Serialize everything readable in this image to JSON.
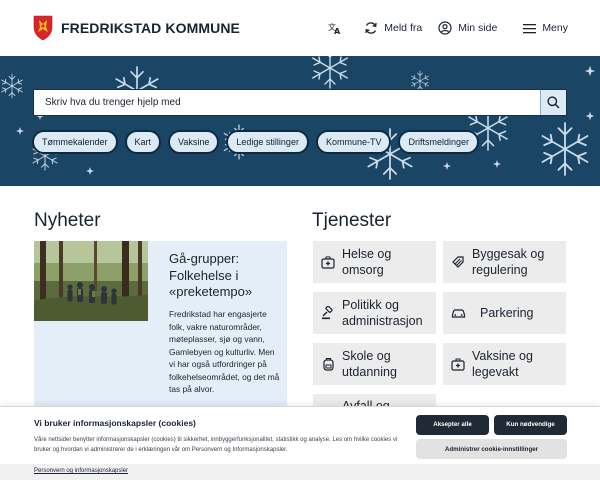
{
  "header": {
    "logo_text": "FREDRIKSTAD KOMMUNE",
    "nav": {
      "meld_fra": "Meld fra",
      "min_side": "Min side",
      "meny": "Meny"
    }
  },
  "banner": {
    "background_color": "#1b4565",
    "search_placeholder": "Skriv hva du trenger hjelp med",
    "chips": [
      "Tømmekalender",
      "Kart",
      "Vaksine",
      "Ledige stillinger",
      "Kommune-TV",
      "Driftsmeldinger"
    ]
  },
  "news": {
    "heading": "Nyheter",
    "card": {
      "title": "Gå-grupper: Folkehelse i «preketempo»",
      "body": "Fredrikstad har engasjerte folk, vakre naturområder, møteplasser, sjø og vann, Gamlebyen og kulturliv. Men vi har også utfordringer på folkehelseområdet, og det må tas på alvor."
    }
  },
  "services": {
    "heading": "Tjenester",
    "items": [
      {
        "label": "Helse og omsorg",
        "icon": "medical-kit-icon"
      },
      {
        "label": "Byggesak og regulering",
        "icon": "building-tag-icon"
      },
      {
        "label": "Politikk og administrasjon",
        "icon": "gavel-icon"
      },
      {
        "label": "Parkering",
        "icon": "car-icon"
      },
      {
        "label": "Skole og utdanning",
        "icon": "backpack-icon"
      },
      {
        "label": "Vaksine og legevakt",
        "icon": "medical-case-icon"
      },
      {
        "label": "Avfall og",
        "icon": "waste-icon"
      }
    ]
  },
  "cookie": {
    "title": "Vi bruker informasjonskapsler (cookies)",
    "text": "Våre nettsider benytter informasjonskapsler (cookies) til sikkerhet, innbyggerfunksjonalitet, statistikk og analyse. Les om hvilke cookies vi bruker og hvordan vi administrerer de i erklæringen vår om Personvern og Informasjonskapsler.",
    "accept_all": "Aksepter alle",
    "only_necessary": "Kun nødvendige",
    "manage": "Administrer cookie-innstillinger",
    "footer_link": "Personvern og informasjonskapsler"
  }
}
